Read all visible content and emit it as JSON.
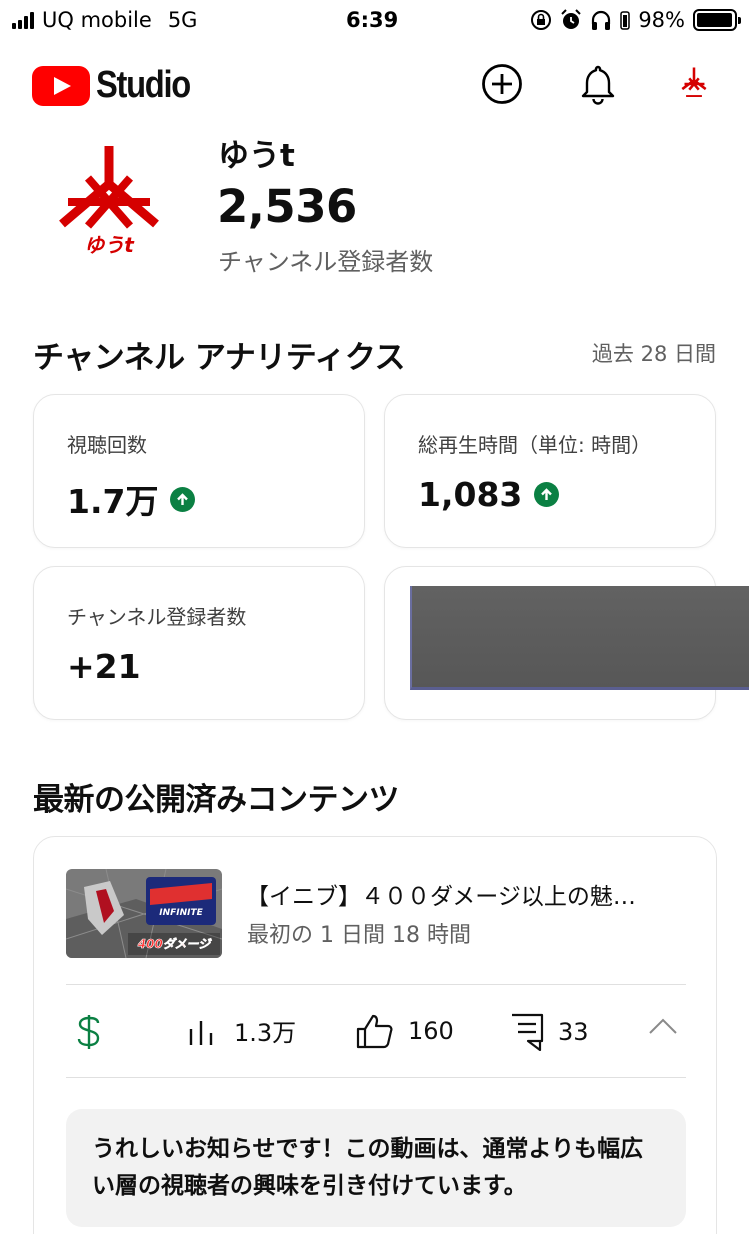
{
  "status_bar": {
    "carrier": "UQ mobile",
    "network": "5G",
    "time": "6:39",
    "battery_percent": "98%",
    "battery_level": 0.98
  },
  "header": {
    "app_name": "Studio",
    "icons": [
      "create-icon",
      "notifications-icon",
      "account-avatar"
    ]
  },
  "channel": {
    "name": "ゆうt",
    "avatar_text": "ゆうt",
    "subscriber_count": "2,536",
    "subscriber_label": "チャンネル登録者数"
  },
  "analytics": {
    "title": "チャンネル アナリティクス",
    "period": "過去 28 日間",
    "cards": [
      {
        "label": "視聴回数",
        "value": "1.7万",
        "trend": "up"
      },
      {
        "label": "総再生時間（単位: 時間）",
        "value": "1,083",
        "trend": "up"
      },
      {
        "label": "チャンネル登録者数",
        "value": "+21"
      }
    ]
  },
  "latest_content": {
    "title": "最新の公開済みコンテンツ",
    "video": {
      "title": "【イニブ】４００ダメージ以上の魅…",
      "subtitle": "最初の 1 日間 18 時間",
      "thumbnail_text": "400ダメージ"
    },
    "stats": {
      "views": "1.3万",
      "likes": "160",
      "comments": "33"
    },
    "notice": "うれしいお知らせです！この動画は、通常よりも幅広い層の視聴者の興味を引き付けています。"
  },
  "colors": {
    "brand_red": "#ff0000",
    "trend_green": "#0b8043",
    "monetization_green": "#0b8043",
    "secondary_text": "#606060",
    "avatar_red": "#d50000"
  }
}
